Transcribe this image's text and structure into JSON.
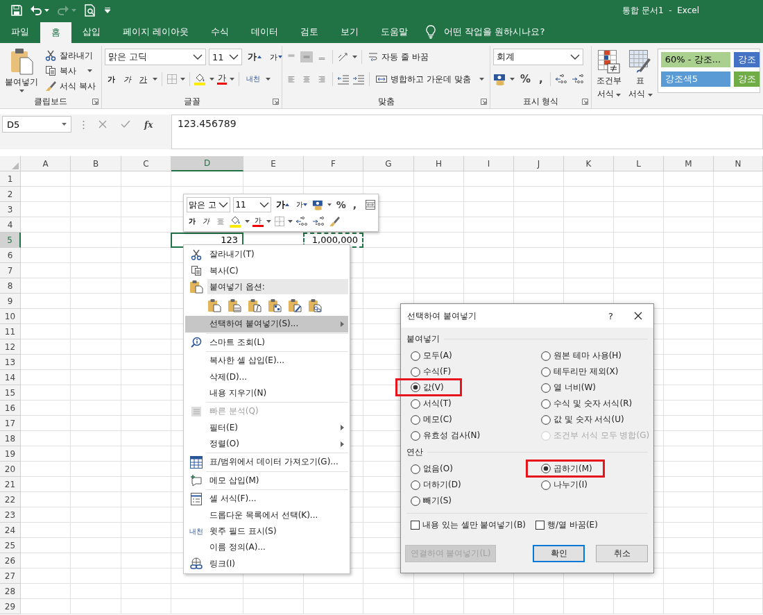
{
  "title_bar": {
    "title": "통합 문서1  -  Excel"
  },
  "tabs": [
    {
      "label": "파일",
      "selected": false
    },
    {
      "label": "홈",
      "selected": true
    },
    {
      "label": "삽입",
      "selected": false
    },
    {
      "label": "페이지 레이아웃",
      "selected": false
    },
    {
      "label": "수식",
      "selected": false
    },
    {
      "label": "데이터",
      "selected": false
    },
    {
      "label": "검토",
      "selected": false
    },
    {
      "label": "보기",
      "selected": false
    },
    {
      "label": "도움말",
      "selected": false
    }
  ],
  "tell_me": {
    "placeholder": "어떤 작업을 원하시나요?"
  },
  "ribbon": {
    "clipboard": {
      "paste": "붙여넣기",
      "cut": "잘라내기",
      "copy": "복사",
      "format_painter": "서식 복사",
      "label": "클립보드"
    },
    "font": {
      "font_name": "맑은 고딕",
      "font_size": "11",
      "grow": "가",
      "shrink": "가",
      "bold": "가",
      "italic": "가",
      "underline": "가",
      "font_color": "가",
      "phonetic": "내천",
      "label": "글꼴"
    },
    "alignment": {
      "vertical": [
        {
          "selected": false
        },
        {
          "selected": true
        },
        {
          "selected": false
        }
      ],
      "wrap_text": "자동 줄 바꿈",
      "merge_center": "병합하고 가운데 맞춤",
      "label": "맞춤"
    },
    "number": {
      "format": "회계",
      "percent": "%",
      "comma": ",",
      "label": "표시 형식"
    },
    "styles": {
      "conditional": [
        "조건부",
        "서식"
      ],
      "format_table": [
        "표",
        "서식"
      ],
      "gallery": [
        {
          "label": "60% - 강조...",
          "color": "#a9d08e"
        },
        {
          "label": "강조",
          "color": "#4472c4"
        },
        {
          "label": "강조색5",
          "color": "#5b9bd5"
        },
        {
          "label": "강조",
          "color": "#70ad47"
        }
      ]
    }
  },
  "formula_bar": {
    "name_box": "D5",
    "function_button": "fx",
    "formula": "123.456789"
  },
  "sheet": {
    "columns": [
      {
        "label": "A",
        "selected": false
      },
      {
        "label": "B",
        "selected": false
      },
      {
        "label": "C",
        "selected": false
      },
      {
        "label": "D",
        "selected": true
      },
      {
        "label": "E",
        "selected": false
      },
      {
        "label": "F",
        "selected": false
      },
      {
        "label": "G",
        "selected": false
      },
      {
        "label": "H",
        "selected": false
      },
      {
        "label": "I",
        "selected": false
      },
      {
        "label": "J",
        "selected": false
      },
      {
        "label": "K",
        "selected": false
      },
      {
        "label": "L",
        "selected": false
      },
      {
        "label": "M",
        "selected": false
      },
      {
        "label": "N",
        "selected": false
      }
    ],
    "rows": [
      {
        "label": "1",
        "selected": false
      },
      {
        "label": "2",
        "selected": false
      },
      {
        "label": "3",
        "selected": false
      },
      {
        "label": "4",
        "selected": false
      },
      {
        "label": "5",
        "selected": true,
        "cells": [
          {},
          {},
          {},
          {
            "value": "123",
            "selected": true,
            "copied": false
          },
          {},
          {
            "value": "1,000,000",
            "selected": false,
            "copied": true
          },
          {},
          {},
          {},
          {},
          {},
          {},
          {},
          {}
        ]
      },
      {
        "label": "6",
        "selected": false
      },
      {
        "label": "7",
        "selected": false
      },
      {
        "label": "8",
        "selected": false
      },
      {
        "label": "9",
        "selected": false
      },
      {
        "label": "10",
        "selected": false
      },
      {
        "label": "11",
        "selected": false
      },
      {
        "label": "12",
        "selected": false
      },
      {
        "label": "13",
        "selected": false
      },
      {
        "label": "14",
        "selected": false
      },
      {
        "label": "15",
        "selected": false
      },
      {
        "label": "16",
        "selected": false
      },
      {
        "label": "17",
        "selected": false
      },
      {
        "label": "18",
        "selected": false
      },
      {
        "label": "19",
        "selected": false
      },
      {
        "label": "20",
        "selected": false
      },
      {
        "label": "21",
        "selected": false
      },
      {
        "label": "22",
        "selected": false
      },
      {
        "label": "23",
        "selected": false
      },
      {
        "label": "24",
        "selected": false
      },
      {
        "label": "25",
        "selected": false
      },
      {
        "label": "26",
        "selected": false
      },
      {
        "label": "27",
        "selected": false
      },
      {
        "label": "28",
        "selected": false
      },
      {
        "label": "29",
        "selected": false
      }
    ]
  },
  "mini_toolbar": {
    "font_name": "맑은 고",
    "font_size": "11",
    "grow": "가",
    "shrink": "가",
    "percent": "%",
    "comma": ",",
    "bold": "가",
    "italic": "가",
    "font_color": "가"
  },
  "context_menu": {
    "items": [
      {
        "kind": "item",
        "label": "잘라내기(T)",
        "selected": false,
        "disabled": false,
        "submenu": false
      },
      {
        "kind": "item",
        "label": "복사(C)",
        "selected": false,
        "disabled": false,
        "submenu": false
      },
      {
        "kind": "header",
        "label": "붙여넣기 옵션:"
      },
      {
        "kind": "paste_options"
      },
      {
        "kind": "item",
        "label": "선택하여 붙여넣기(S)...",
        "selected": true,
        "disabled": false,
        "submenu": true
      },
      {
        "kind": "separator"
      },
      {
        "kind": "item",
        "label": "스마트 조회(L)",
        "selected": false,
        "disabled": false,
        "submenu": false
      },
      {
        "kind": "separator"
      },
      {
        "kind": "item",
        "label": "복사한 셀 삽입(E)...",
        "selected": false,
        "disabled": false,
        "submenu": false
      },
      {
        "kind": "item",
        "label": "삭제(D)...",
        "selected": false,
        "disabled": false,
        "submenu": false
      },
      {
        "kind": "item",
        "label": "내용 지우기(N)",
        "selected": false,
        "disabled": false,
        "submenu": false
      },
      {
        "kind": "separator"
      },
      {
        "kind": "item",
        "label": "빠른 분석(Q)",
        "selected": false,
        "disabled": true,
        "submenu": false
      },
      {
        "kind": "item",
        "label": "필터(E)",
        "selected": false,
        "disabled": false,
        "submenu": true
      },
      {
        "kind": "item",
        "label": "정렬(O)",
        "selected": false,
        "disabled": false,
        "submenu": true
      },
      {
        "kind": "separator"
      },
      {
        "kind": "item",
        "label": "표/범위에서 데이터 가져오기(G)...",
        "selected": false,
        "disabled": false,
        "submenu": false
      },
      {
        "kind": "separator"
      },
      {
        "kind": "item",
        "label": "메모 삽입(M)",
        "selected": false,
        "disabled": false,
        "submenu": false
      },
      {
        "kind": "separator"
      },
      {
        "kind": "item",
        "label": "셀 서식(F)...",
        "selected": false,
        "disabled": false,
        "submenu": false
      },
      {
        "kind": "item",
        "label": "드롭다운 목록에서 선택(K)...",
        "selected": false,
        "disabled": false,
        "submenu": false
      },
      {
        "kind": "item",
        "label": "윗주 필드 표시(S)",
        "glyph": "내천",
        "selected": false,
        "disabled": false,
        "submenu": false
      },
      {
        "kind": "item",
        "label": "이름 정의(A)...",
        "selected": false,
        "disabled": false,
        "submenu": false
      },
      {
        "kind": "item",
        "label": "링크(I)",
        "selected": false,
        "disabled": false,
        "submenu": false
      }
    ]
  },
  "paste_special": {
    "title": "선택하여 붙여넣기",
    "help": "?",
    "paste_label": "붙여넣기",
    "paste_options": [
      {
        "label": "모두(A)",
        "selected": false,
        "disabled": false,
        "highlighted": false
      },
      {
        "label": "수식(F)",
        "selected": false,
        "disabled": false,
        "highlighted": false
      },
      {
        "label": "값(V)",
        "selected": true,
        "disabled": false,
        "highlighted": true
      },
      {
        "label": "서식(T)",
        "selected": false,
        "disabled": false,
        "highlighted": false
      },
      {
        "label": "메모(C)",
        "selected": false,
        "disabled": false,
        "highlighted": false
      },
      {
        "label": "유효성 검사(N)",
        "selected": false,
        "disabled": false,
        "highlighted": false
      },
      {
        "label": "원본 테마 사용(H)",
        "selected": false,
        "disabled": false,
        "highlighted": false
      },
      {
        "label": "테두리만 제외(X)",
        "selected": false,
        "disabled": false,
        "highlighted": false
      },
      {
        "label": "열 너비(W)",
        "selected": false,
        "disabled": false,
        "highlighted": false
      },
      {
        "label": "수식 및 숫자 서식(R)",
        "selected": false,
        "disabled": false,
        "highlighted": false
      },
      {
        "label": "값 및 숫자 서식(U)",
        "selected": false,
        "disabled": false,
        "highlighted": false
      },
      {
        "label": "조건부 서식 모두 병합(G)",
        "selected": false,
        "disabled": true,
        "highlighted": false
      }
    ],
    "operation_label": "연산",
    "operations": [
      {
        "label": "없음(O)",
        "selected": false,
        "highlighted": false
      },
      {
        "label": "더하기(D)",
        "selected": false,
        "highlighted": false
      },
      {
        "label": "빼기(S)",
        "selected": false,
        "highlighted": false
      },
      {
        "label": "곱하기(M)",
        "selected": true,
        "highlighted": true
      },
      {
        "label": "나누기(I)",
        "selected": false,
        "highlighted": false
      }
    ],
    "checkboxes": [
      {
        "label": "내용 있는 셀만 붙여넣기(B)",
        "checked": false
      },
      {
        "label": "행/열 바꿈(E)",
        "checked": false
      }
    ],
    "buttons": [
      {
        "label": "연결하여 붙여넣기(L)",
        "disabled": true,
        "default": false
      },
      {
        "label": "확인",
        "disabled": false,
        "default": true
      },
      {
        "label": "취소",
        "disabled": false,
        "default": false
      }
    ]
  }
}
